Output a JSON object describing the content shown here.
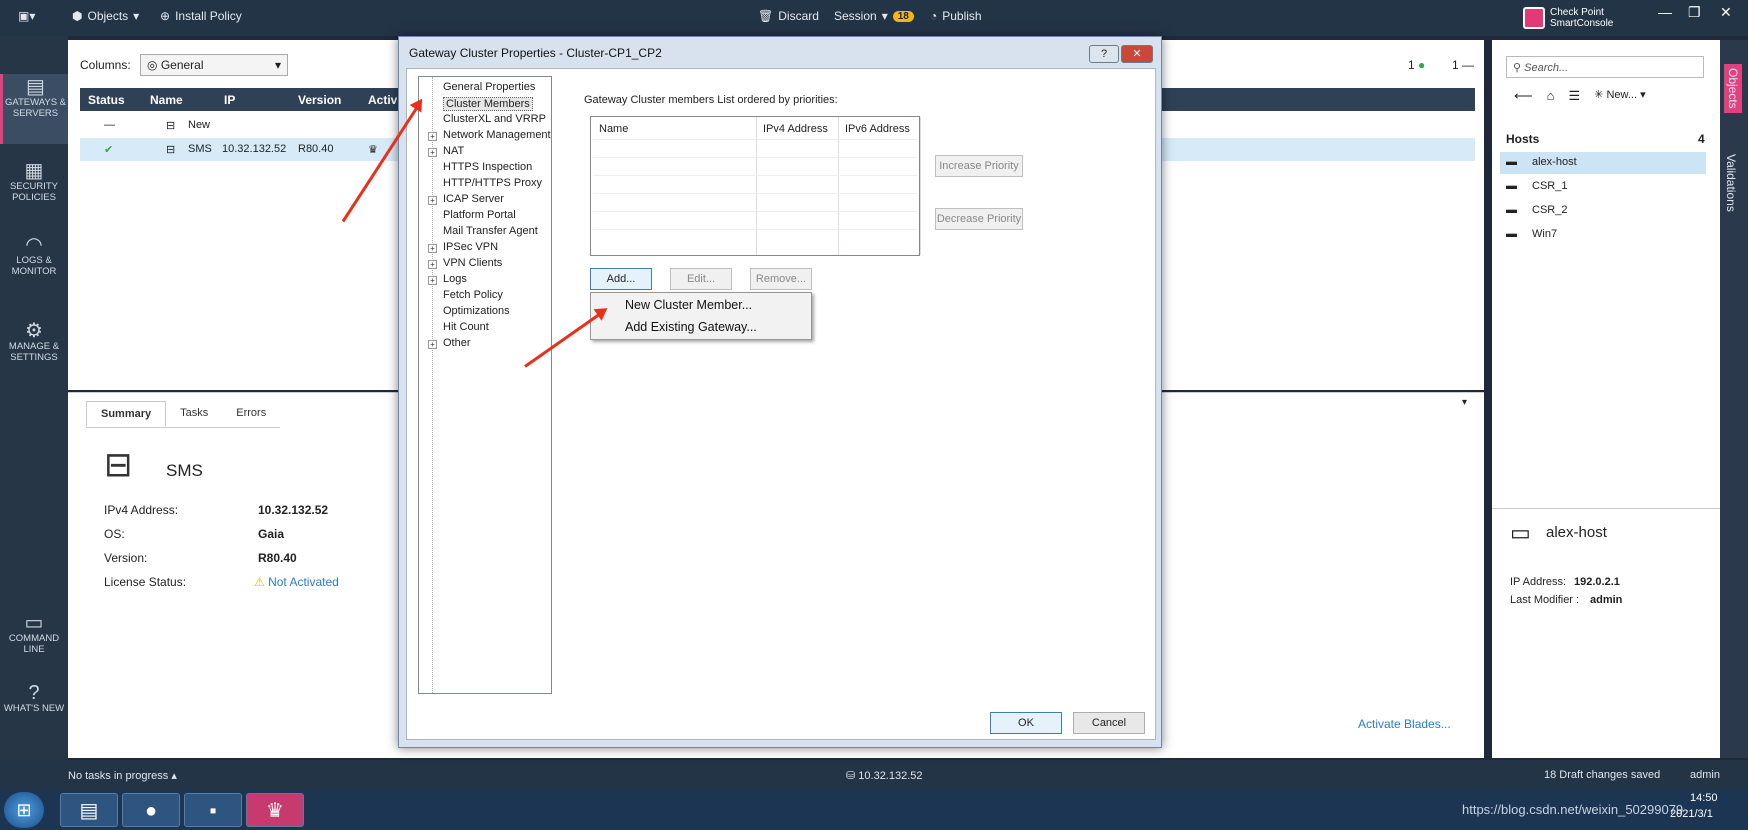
{
  "topbar": {
    "menu_label": "",
    "objects": "Objects",
    "install_policy": "Install Policy",
    "discard": "Discard",
    "session": "Session",
    "session_count": "18",
    "publish": "Publish",
    "brand_line1": "Check Point",
    "brand_line2": "SmartConsole"
  },
  "nav": {
    "items": [
      {
        "label": "GATEWAYS & SERVERS"
      },
      {
        "label": "SECURITY POLICIES"
      },
      {
        "label": "LOGS & MONITOR"
      },
      {
        "label": "MANAGE & SETTINGS"
      },
      {
        "label": "COMMAND LINE"
      },
      {
        "label": "WHAT'S NEW"
      }
    ]
  },
  "main": {
    "columns_label": "Columns:",
    "columns_value": "General",
    "count_ok": "1",
    "count_dash": "1",
    "headers": [
      "Status",
      "Name",
      "IP",
      "Version",
      "Activ"
    ],
    "rows": [
      {
        "status": "—",
        "name": "New",
        "ip": "",
        "version": ""
      },
      {
        "status": "✔",
        "name": "SMS",
        "ip": "10.32.132.52",
        "version": "R80.40"
      }
    ]
  },
  "summary": {
    "tabs": [
      "Summary",
      "Tasks",
      "Errors"
    ],
    "object_name": "SMS",
    "ipv4_label": "IPv4 Address:",
    "ipv4": "10.32.132.52",
    "os_label": "OS:",
    "os": "Gaia",
    "version_label": "Version:",
    "version": "R80.40",
    "license_label": "License Status:",
    "license": "Not Activated",
    "activate_link": "Activate Blades..."
  },
  "dialog": {
    "title": "Gateway Cluster Properties - Cluster-CP1_CP2",
    "help": "?",
    "close": "✕",
    "tree": [
      "General Properties",
      "Cluster Members",
      "ClusterXL and VRRP",
      "Network Management",
      "NAT",
      "HTTPS Inspection",
      "HTTP/HTTPS Proxy",
      "ICAP Server",
      "Platform Portal",
      "Mail Transfer Agent",
      "IPSec VPN",
      "VPN Clients",
      "Logs",
      "Fetch Policy",
      "Optimizations",
      "Hit Count",
      "Other"
    ],
    "list_caption": "Gateway Cluster members List ordered by priorities:",
    "list_headers": [
      "Name",
      "IPv4 Address",
      "IPv6 Address"
    ],
    "increase": "Increase Priority",
    "decrease": "Decrease Priority",
    "add": "Add...",
    "edit": "Edit...",
    "remove": "Remove...",
    "menu": [
      "New Cluster Member...",
      "Add Existing Gateway..."
    ],
    "ok": "OK",
    "cancel": "Cancel"
  },
  "right": {
    "search_placeholder": "Search...",
    "new": "New...",
    "hosts_label": "Hosts",
    "hosts_count": "4",
    "hosts": [
      "alex-host",
      "CSR_1",
      "CSR_2",
      "Win7"
    ],
    "detail_name": "alex-host",
    "ip_label": "IP Address:",
    "ip": "192.0.2.1",
    "modifier_label": "Last Modifier :",
    "modifier": "admin",
    "vtabs": [
      "Objects",
      "Validations"
    ]
  },
  "status": {
    "tasks": "No tasks in progress",
    "server": "10.32.132.52",
    "drafts": "18 Draft changes saved",
    "user": "admin"
  },
  "taskbar": {
    "watermark": "https://blog.csdn.net/weixin_50299079",
    "time": "14:50",
    "date": "2021/3/1"
  }
}
